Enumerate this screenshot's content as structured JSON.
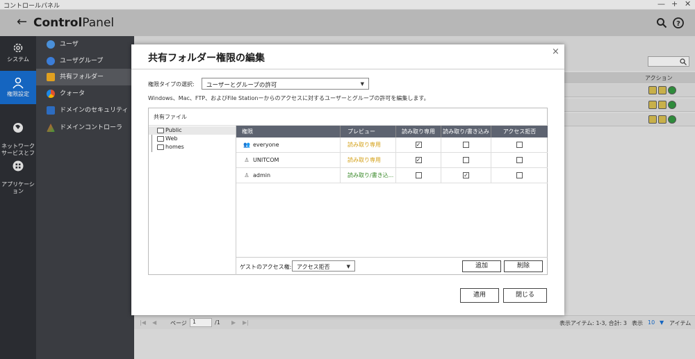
{
  "window": {
    "title": "コントロールパネル",
    "controls": [
      "—",
      "+",
      "✕"
    ]
  },
  "header": {
    "back": "←",
    "title_a": "Control",
    "title_b": "Panel"
  },
  "nav1": [
    {
      "label": "システム",
      "icon": "gear-icon"
    },
    {
      "label": "権限設定",
      "icon": "user-icon",
      "selected": true
    },
    {
      "label": "ネットワーク\nサービスとフ",
      "icon": "network-icon"
    },
    {
      "label": "アプリケーシ\nョン",
      "icon": "apps-icon"
    }
  ],
  "nav2": [
    {
      "label": "ユーザ",
      "color": "#4a90d9"
    },
    {
      "label": "ユーザグループ",
      "color": "#3b7dd8"
    },
    {
      "label": "共有フォルダー",
      "color": "#e0a020",
      "selected": true
    },
    {
      "label": "クォータ",
      "color": "#e05030"
    },
    {
      "label": "ドメインのセキュリティ",
      "color": "#2d6cc0"
    },
    {
      "label": "ドメインコントローラ",
      "color": "#3a9a3a"
    }
  ],
  "main": {
    "action_header": "アクション"
  },
  "footer": {
    "page_label": "ページ",
    "page_value": "1",
    "page_total": "/1",
    "display_items": "表示アイテム: 1-3, 合計: 3",
    "display": "表示",
    "per_page": "10",
    "items": "アイテム"
  },
  "modal": {
    "title": "共有フォルダー権限の編集",
    "close": "×",
    "type_label": "権限タイプの選択:",
    "type_value": "ユーザーとグループの許可",
    "description": "Windows、Mac、FTP、およびFile Stationーからのアクセスに対するユーザーとグループの許可を編集します。",
    "box_title": "共有ファイル",
    "tree": [
      "Public",
      "Web",
      "homes"
    ],
    "columns": [
      "権限",
      "プレビュー",
      "読み取り専用",
      "読み取り/書き込み",
      "アクセス拒否"
    ],
    "rows": [
      {
        "name": "everyone",
        "preview": "読み取り専用",
        "preview_color": "#d4a017",
        "ro": true,
        "rw": false,
        "deny": false
      },
      {
        "name": "UNITCOM",
        "preview": "読み取り専用",
        "preview_color": "#d4a017",
        "ro": true,
        "rw": false,
        "deny": false
      },
      {
        "name": "admin",
        "preview": "読み取り/書き込...",
        "preview_color": "#3a8a2a",
        "ro": false,
        "rw": true,
        "deny": false
      }
    ],
    "guest_label": "ゲストのアクセス権:",
    "guest_value": "アクセス拒否",
    "add": "追加",
    "delete": "削除",
    "apply": "適用",
    "close_btn": "閉じる"
  }
}
